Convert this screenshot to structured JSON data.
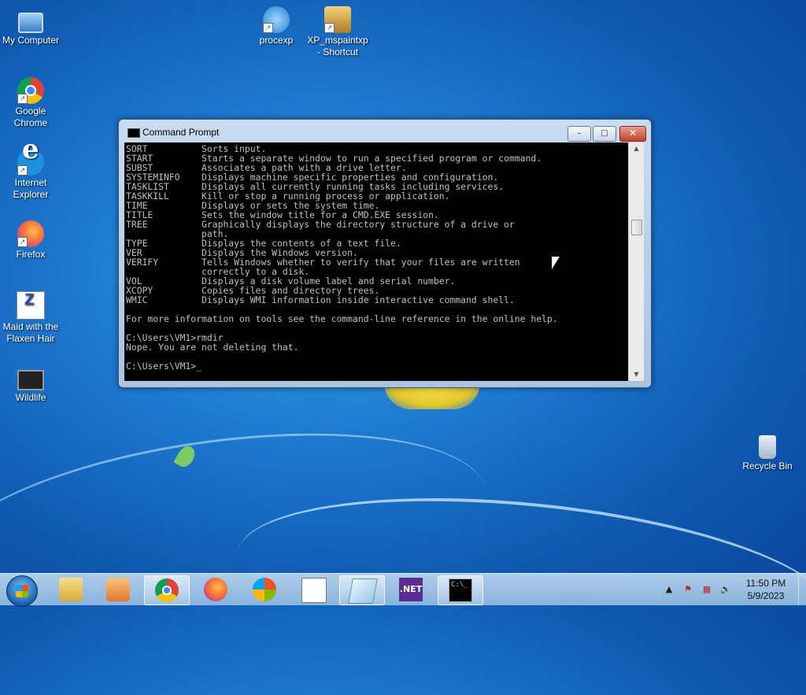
{
  "desktop": {
    "icons": [
      {
        "label": "My Computer"
      },
      {
        "label": "Google Chrome"
      },
      {
        "label": "Internet Explorer"
      },
      {
        "label": "Firefox"
      },
      {
        "label": "Maid with the Flaxen Hair"
      },
      {
        "label": "Wildlife"
      },
      {
        "label": "procexp"
      },
      {
        "label": "XP_mspaintxp - Shortcut"
      },
      {
        "label": "Recycle Bin"
      }
    ]
  },
  "window": {
    "title": "Command Prompt",
    "controls": {
      "minimize": "–",
      "maximize": "□",
      "close": "✕"
    },
    "console_text": "SORT          Sorts input.\nSTART         Starts a separate window to run a specified program or command.\nSUBST         Associates a path with a drive letter.\nSYSTEMINFO    Displays machine specific properties and configuration.\nTASKLIST      Displays all currently running tasks including services.\nTASKKILL      Kill or stop a running process or application.\nTIME          Displays or sets the system time.\nTITLE         Sets the window title for a CMD.EXE session.\nTREE          Graphically displays the directory structure of a drive or\n              path.\nTYPE          Displays the contents of a text file.\nVER           Displays the Windows version.\nVERIFY        Tells Windows whether to verify that your files are written\n              correctly to a disk.\nVOL           Displays a disk volume label and serial number.\nXCOPY         Copies files and directory trees.\nWMIC          Displays WMI information inside interactive command shell.\n\nFor more information on tools see the command-line reference in the online help.\n\nC:\\Users\\VM1>rmdir\nNope. You are not deleting that.\n\nC:\\Users\\VM1>",
    "cursor": "_"
  },
  "taskbar": {
    "net_label": ".NET",
    "cmd_label": "C:\\_",
    "tray": {
      "arrow": "▲"
    },
    "clock": {
      "time": "11:50 PM",
      "date": "5/9/2023"
    }
  },
  "colors": {
    "console_bg": "#000000",
    "console_fg": "#c0c0c0",
    "close_button": "#c0402a"
  }
}
